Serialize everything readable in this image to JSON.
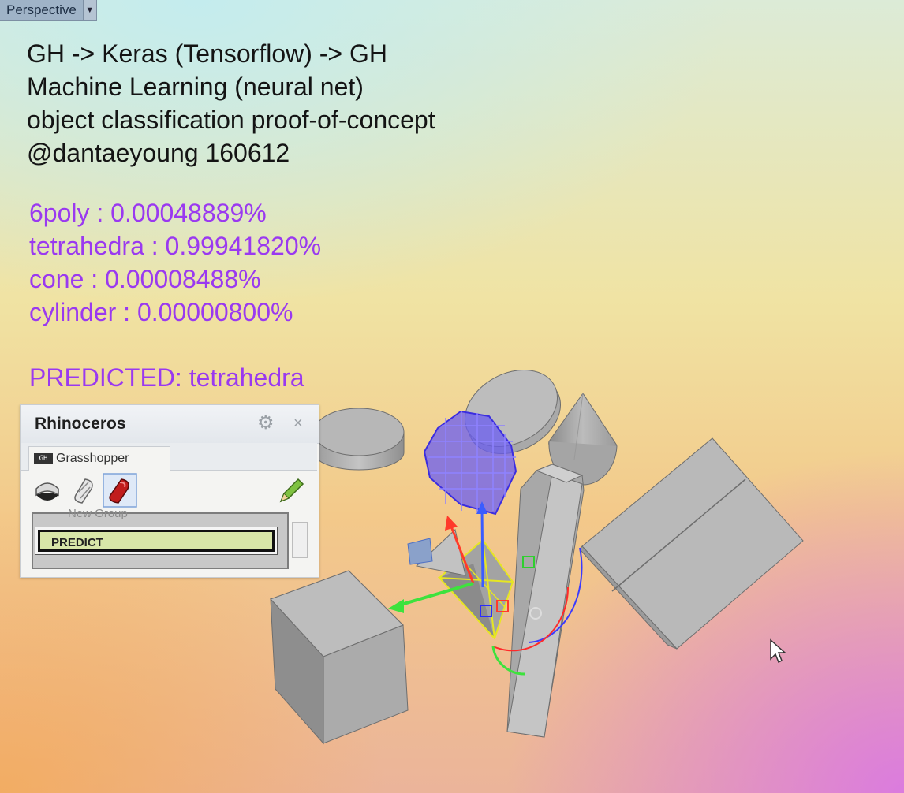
{
  "viewport": {
    "tab_label": "Perspective"
  },
  "header_lines": [
    "GH -> Keras (Tensorflow) -> GH",
    "Machine Learning (neural net)",
    "object classification proof-of-concept",
    "@dantaeyoung 160612"
  ],
  "probabilities": [
    "6poly : 0.00048889%",
    "tetrahedra : 0.99941820%",
    "cone : 0.00008488%",
    "cylinder : 0.00000800%"
  ],
  "prediction": "PREDICTED: tetrahedra",
  "panel": {
    "title": "Rhinoceros",
    "tab": "Grasshopper",
    "tab_icon_text": "GH",
    "group_label": "New Group",
    "button_label": "PREDICT"
  },
  "colors": {
    "accent_purple": "#9a39f0",
    "predict_button": "#d8e6a8"
  }
}
